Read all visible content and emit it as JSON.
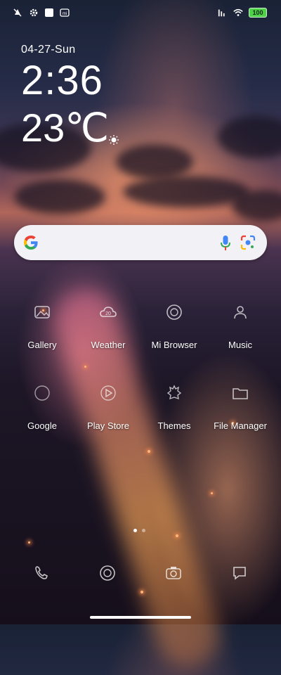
{
  "status_bar": {
    "left_icons": [
      "no-notification-icon",
      "settings-gear-icon",
      "square-icon",
      "mi-icon"
    ],
    "battery": "100",
    "right_icons": [
      "signal-icon",
      "wifi-icon",
      "battery-icon"
    ]
  },
  "widget": {
    "date": "04-27-Sun",
    "time": "2:36",
    "temperature": "23℃"
  },
  "search": {
    "icons": [
      "google-logo-icon",
      "microphone-icon",
      "google-lens-icon"
    ]
  },
  "apps_row1": [
    {
      "label": "Gallery",
      "icon": "gallery-icon"
    },
    {
      "label": "Weather",
      "icon": "weather-icon"
    },
    {
      "label": "Mi Browser",
      "icon": "browser-icon"
    },
    {
      "label": "Music",
      "icon": "music-icon"
    }
  ],
  "apps_row2": [
    {
      "label": "Google",
      "icon": "google-icon"
    },
    {
      "label": "Play Store",
      "icon": "play-store-icon"
    },
    {
      "label": "Themes",
      "icon": "themes-icon"
    },
    {
      "label": "File Manager",
      "icon": "folder-icon"
    }
  ],
  "page_indicator": {
    "pages": 2,
    "current": 1
  },
  "dock": [
    "phone-icon",
    "browser-icon",
    "camera-icon",
    "messages-icon"
  ],
  "colors": {
    "battery": "#4fd24a",
    "search_bg": "#f2f1f6"
  }
}
